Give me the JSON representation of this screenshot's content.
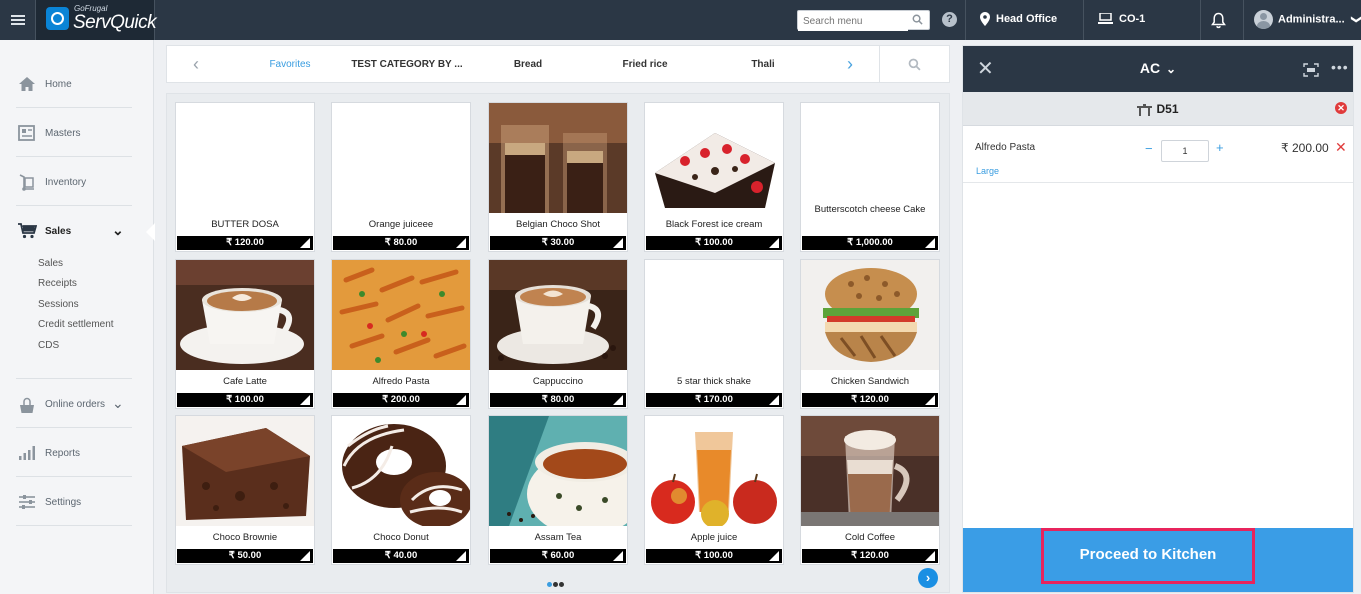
{
  "app": {
    "brand_sub": "GoFrugal",
    "brand_main": "ServQuick"
  },
  "topbar": {
    "search_placeholder": "Search menu",
    "help_label": "?",
    "location": "Head Office",
    "counter": "CO-1",
    "user": "Administra...",
    "user_chevron": "❯"
  },
  "sidebar": {
    "items": [
      {
        "label": "Home",
        "icon": "home-icon"
      },
      {
        "label": "Masters",
        "icon": "masters-icon"
      },
      {
        "label": "Inventory",
        "icon": "inventory-icon"
      },
      {
        "label": "Sales",
        "icon": "cart-icon",
        "chevron": "⌄"
      },
      {
        "label": "Online orders",
        "icon": "online-orders-icon",
        "chevron": "⌄"
      },
      {
        "label": "Reports",
        "icon": "reports-icon"
      },
      {
        "label": "Settings",
        "icon": "settings-icon"
      }
    ],
    "sales_sub": [
      "Sales",
      "Receipts",
      "Sessions",
      "Credit settlement",
      "CDS"
    ]
  },
  "categories": {
    "prev": "‹",
    "next": "›",
    "tabs": [
      "Favorites",
      "TEST CATEGORY BY ...",
      "Bread",
      "Fried rice",
      "Thali"
    ],
    "selected": "Favorites"
  },
  "products": [
    {
      "name": "BUTTER DOSA",
      "price": "₹ 120.00",
      "image": "none"
    },
    {
      "name": "Orange juiceee",
      "price": "₹ 80.00",
      "image": "none"
    },
    {
      "name": "Belgian Choco Shot",
      "price": "₹ 30.00",
      "image": "choco-shot"
    },
    {
      "name": "Black Forest ice cream",
      "price": "₹ 100.00",
      "image": "black-forest"
    },
    {
      "name": "Butterscotch cheese Cake",
      "price": "₹ 1,000.00",
      "image": "none"
    },
    {
      "name": "Cafe Latte",
      "price": "₹ 100.00",
      "image": "latte"
    },
    {
      "name": "Alfredo Pasta",
      "price": "₹ 200.00",
      "image": "pasta"
    },
    {
      "name": "Cappuccino",
      "price": "₹ 80.00",
      "image": "cappuccino"
    },
    {
      "name": "5 star thick shake",
      "price": "₹ 170.00",
      "image": "none"
    },
    {
      "name": "Chicken Sandwich",
      "price": "₹ 120.00",
      "image": "sandwich"
    },
    {
      "name": "Choco Brownie",
      "price": "₹ 50.00",
      "image": "brownie"
    },
    {
      "name": "Choco Donut",
      "price": "₹ 40.00",
      "image": "donut"
    },
    {
      "name": "Assam Tea",
      "price": "₹ 60.00",
      "image": "tea"
    },
    {
      "name": "Apple juice",
      "price": "₹ 100.00",
      "image": "apple-juice"
    },
    {
      "name": "Cold Coffee",
      "price": "₹ 120.00",
      "image": "cold-coffee"
    }
  ],
  "pager": {
    "pages": 3,
    "current": 1,
    "next": "›"
  },
  "order": {
    "close": "✕",
    "section": "AC",
    "section_chevron": "⌄",
    "more": "•••",
    "table": "D51",
    "table_remove": "✕",
    "line_items": [
      {
        "name": "Alfredo Pasta",
        "variant": "Large",
        "qty": "1",
        "price": "₹ 200.00",
        "minus": "−",
        "plus": "+",
        "remove": "✕"
      }
    ],
    "proceed_label": "Proceed to Kitchen"
  },
  "colors": {
    "topbar": "#2b3745",
    "accent": "#3a9de0",
    "proceed": "#3a9de6",
    "highlight": "#e8245c",
    "danger": "#e03b3b"
  }
}
